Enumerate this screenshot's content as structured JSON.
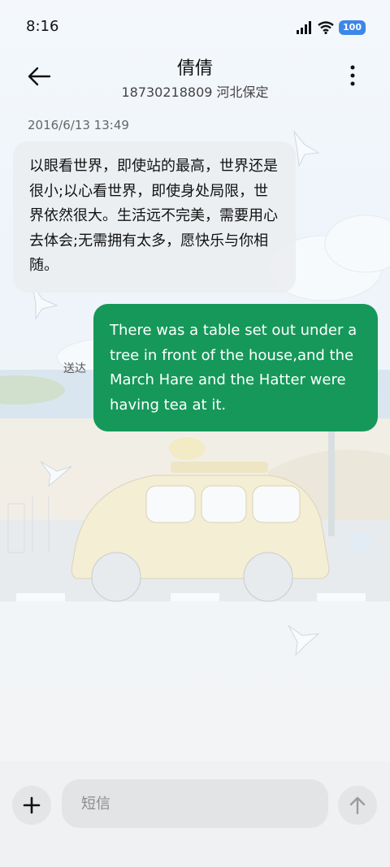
{
  "status_bar": {
    "time": "8:16",
    "battery": "100"
  },
  "header": {
    "contact_name": "倩倩",
    "contact_sub": "18730218809 河北保定"
  },
  "conversation": {
    "timestamp": "2016/6/13 13:49",
    "incoming_message": "以眼看世界，即使站的最高，世界还是很小;以心看世界，即使身处局限，世界依然很大。生活远不完美，需要用心去体会;无需拥有太多，愿快乐与你相随。",
    "outgoing_message": "There was a table set out under a tree in front of the house,and the March Hare and the Hatter were having tea at it.",
    "outgoing_status": "送达"
  },
  "input_bar": {
    "placeholder": "短信"
  },
  "colors": {
    "outgoing_bubble": "#16985a",
    "incoming_bubble": "#eceef1",
    "battery": "#3d87e8"
  },
  "icons": [
    "signal-icon",
    "wifi-icon",
    "battery-icon",
    "back-arrow-icon",
    "more-vert-icon",
    "plus-icon",
    "send-arrow-icon"
  ]
}
